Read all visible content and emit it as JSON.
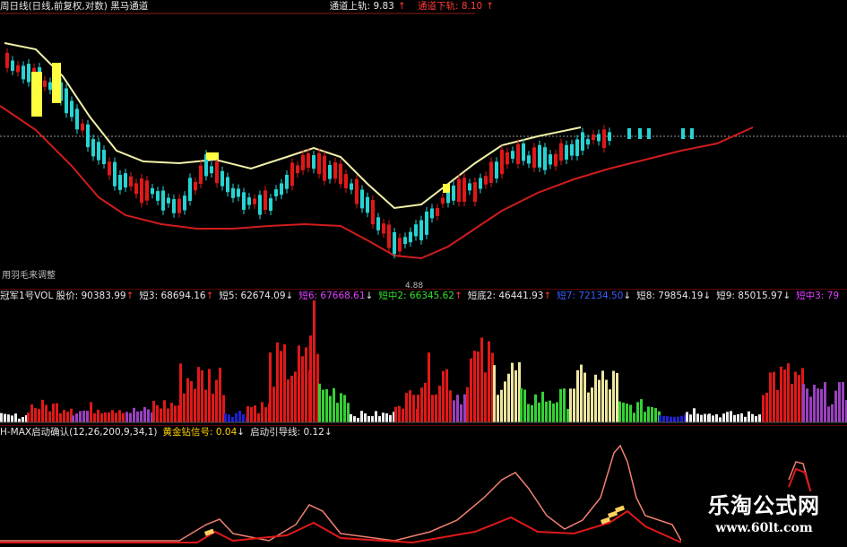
{
  "colors": {
    "up": "#e01818",
    "down": "#27d3d3",
    "upper_band": "#f1f0a8",
    "lower_band": "#d01c1c",
    "vol_red": "#e01818",
    "vol_green": "#35d035",
    "vol_yellow": "#eee6a0",
    "vol_purple": "#9a40c0",
    "vol_blue": "#2020d0",
    "vol_white": "#eeeeee",
    "ind_line1": "#f08070",
    "ind_line2": "#e01818"
  },
  "price_header": {
    "title": "周日线(日线,前复权,对数) 黑马通道",
    "upper_label": "通道上轨: 9.83",
    "upper_arrow": "↑",
    "lower_label": "通道下轨: 8.10",
    "lower_arrow": "↑"
  },
  "price_footer": {
    "pane_label": "用羽毛来调整",
    "center_price": "4.88"
  },
  "volume_header": [
    {
      "text": "冠军1号VOL 股价: 90383.99",
      "arrow": "↑",
      "cls": "c-w"
    },
    {
      "text": "短3: 68694.16",
      "arrow": "↑",
      "cls": "c-w"
    },
    {
      "text": "短5: 62674.09",
      "arrow": "↓",
      "cls": "c-w"
    },
    {
      "text": "短6: 67668.61",
      "arrow": "↓",
      "cls": "c-m"
    },
    {
      "text": "短中2: 66345.62",
      "arrow": "↑",
      "cls": "c-g"
    },
    {
      "text": "短底2: 46441.93",
      "arrow": "↑",
      "cls": "c-w"
    },
    {
      "text": "短7: 72134.50",
      "arrow": "↓",
      "cls": "c-b"
    },
    {
      "text": "短8: 79854.19",
      "arrow": "↓",
      "cls": "c-w"
    },
    {
      "text": "短9: 85015.97",
      "arrow": "↓",
      "cls": "c-w"
    },
    {
      "text": "短中3: 79",
      "arrow": "",
      "cls": "c-m"
    }
  ],
  "indicator_header": [
    {
      "text": "H-MAX启动确认(12,26,200,9,34,1)",
      "arrow": "",
      "cls": "c-w"
    },
    {
      "text": "黄金钻信号: 0.04",
      "arrow": "↓",
      "cls": "c-y"
    },
    {
      "text": "启动引导线: 0.12",
      "arrow": "↓",
      "cls": "c-w"
    }
  ],
  "watermark": {
    "title": "乐淘公式网",
    "url": "www.60lt.com"
  }
}
